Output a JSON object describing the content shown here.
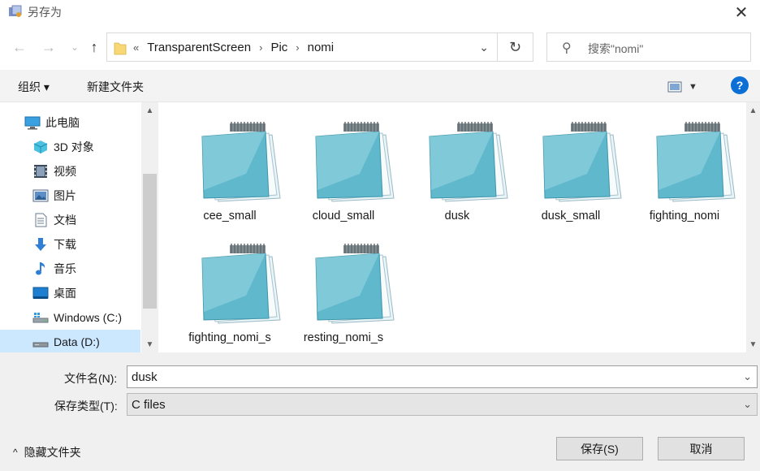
{
  "window": {
    "title": "另存为"
  },
  "nav": {
    "path": [
      "TransparentScreen",
      "Pic",
      "nomi"
    ],
    "overflow_glyph": "«",
    "search_placeholder": "搜索\"nomi\""
  },
  "toolbar": {
    "organize_label": "组织 ▾",
    "new_folder_label": "新建文件夹",
    "help_label": "?"
  },
  "sidebar": {
    "items": [
      {
        "label": "此电脑",
        "icon": "computer-icon"
      },
      {
        "label": "3D 对象",
        "icon": "cube-icon"
      },
      {
        "label": "视频",
        "icon": "video-icon"
      },
      {
        "label": "图片",
        "icon": "picture-icon"
      },
      {
        "label": "文档",
        "icon": "document-icon"
      },
      {
        "label": "下载",
        "icon": "download-arrow-icon"
      },
      {
        "label": "音乐",
        "icon": "music-note-icon"
      },
      {
        "label": "桌面",
        "icon": "desktop-icon"
      },
      {
        "label": "Windows (C:)",
        "icon": "drive-windows-icon"
      },
      {
        "label": "Data (D:)",
        "icon": "drive-icon",
        "selected": true
      }
    ]
  },
  "files": [
    {
      "name": "cee_small"
    },
    {
      "name": "cloud_small"
    },
    {
      "name": "dusk"
    },
    {
      "name": "dusk_small"
    },
    {
      "name": "fighting_nomi"
    },
    {
      "name": "fighting_nomi_s"
    },
    {
      "name": "resting_nomi_s"
    }
  ],
  "form": {
    "filename_label": "文件名(N):",
    "filename_value": "dusk",
    "filetype_label": "保存类型(T):",
    "filetype_value": "C files",
    "hide_folders_label": "隐藏文件夹",
    "save_label": "保存(S)",
    "cancel_label": "取消"
  },
  "colors": {
    "selection": "#cce8ff",
    "help_blue": "#0b6fd6",
    "notepad_teal": "#5fb8cc"
  }
}
